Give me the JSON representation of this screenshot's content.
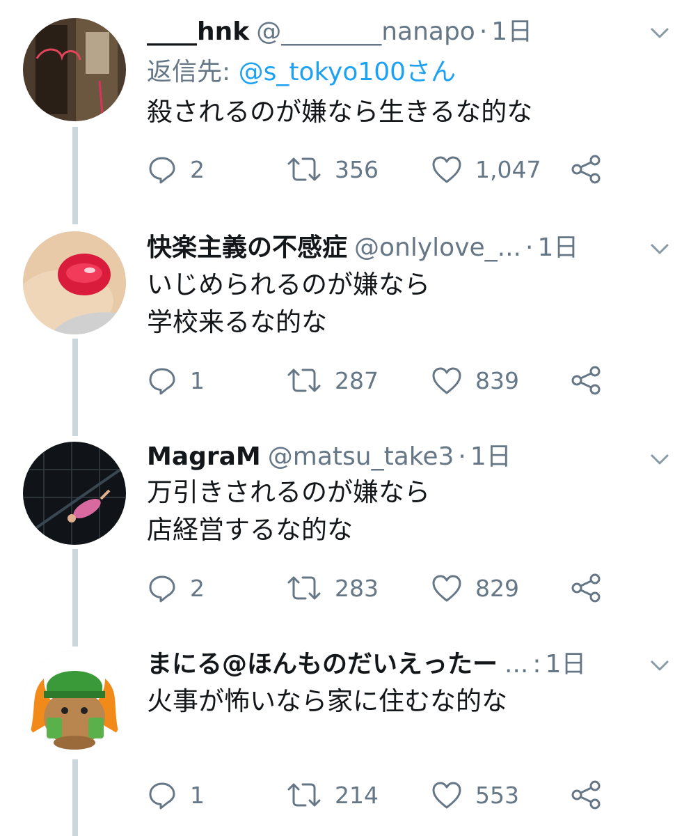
{
  "tweets": [
    {
      "name": "____hnk",
      "handle": "@________nanapo",
      "separator": "·",
      "time": "1日",
      "reply_label": "返信先: ",
      "reply_mention": "@s_tokyo100さん",
      "text": "殺されるのが嫌なら生きるな的な",
      "replies": "2",
      "retweets": "356",
      "likes": "1,047"
    },
    {
      "name": "快楽主義の不感症",
      "handle": "@onlylove_...",
      "separator": "·",
      "time": "1日",
      "text": "いじめられるのが嫌なら\n学校来るな的な",
      "replies": "1",
      "retweets": "287",
      "likes": "839"
    },
    {
      "name": "MagraM",
      "handle": "@matsu_take3",
      "separator": "·",
      "time": "1日",
      "text": "万引きされるのが嫌なら\n店経営するな的な",
      "replies": "2",
      "retweets": "283",
      "likes": "829"
    },
    {
      "name": "まにる@ほんものだいえったー",
      "handle": "...",
      "separator": ":",
      "time": "1日",
      "text": "火事が怖いなら家に住むな的な",
      "replies": "1",
      "retweets": "214",
      "likes": "553"
    }
  ],
  "icons": {
    "caret": "chevron-down-icon",
    "reply": "speech-bubble-icon",
    "retweet": "retweet-arrows-icon",
    "like": "heart-outline-icon",
    "share": "share-nodes-icon"
  },
  "colors": {
    "text": "#14171a",
    "secondary": "#657786",
    "link": "#1da1f2",
    "thread_line": "#ccd6dd"
  }
}
